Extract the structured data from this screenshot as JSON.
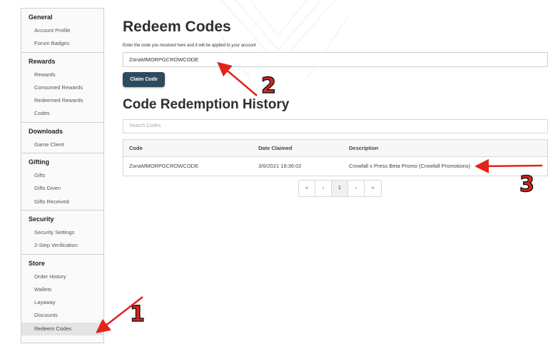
{
  "sidebar": {
    "sections": [
      {
        "title": "General",
        "items": [
          "Account Profile",
          "Forum Badges"
        ]
      },
      {
        "title": "Rewards",
        "items": [
          "Rewards",
          "Consumed Rewards",
          "Redeemed Rewards",
          "Codes"
        ]
      },
      {
        "title": "Downloads",
        "items": [
          "Game Client"
        ]
      },
      {
        "title": "Gifting",
        "items": [
          "Gifts",
          "Gifts Given",
          "Gifts Received"
        ]
      },
      {
        "title": "Security",
        "items": [
          "Security Settings",
          "2-Step Verification"
        ]
      },
      {
        "title": "Store",
        "items": [
          "Order History",
          "Wallets",
          "Layaway",
          "Discounts",
          "Redeem Codes"
        ]
      }
    ],
    "active_item": "Redeem Codes"
  },
  "main": {
    "title": "Redeem Codes",
    "code_label": "Enter the code you received here and it will be applied to your account",
    "code_value": "ZonaMMORPGCROWCODE",
    "claim_button": "Claim Code",
    "history_title": "Code Redemption History",
    "search_placeholder": "Search Codes",
    "table": {
      "headers": [
        "Code",
        "Date Claimed",
        "Description"
      ],
      "rows": [
        [
          "ZonaMMORPGCROWCODE",
          "3/6/2021 16:36:02",
          "Crowfall x Press Beta Promo (Crowfall Promotions)"
        ]
      ]
    },
    "pagination": [
      "«",
      "‹",
      "1",
      "›",
      "»"
    ],
    "current_page": "1"
  },
  "annotations": {
    "labels": [
      "1",
      "2",
      "3"
    ],
    "color": "#e2231a"
  }
}
